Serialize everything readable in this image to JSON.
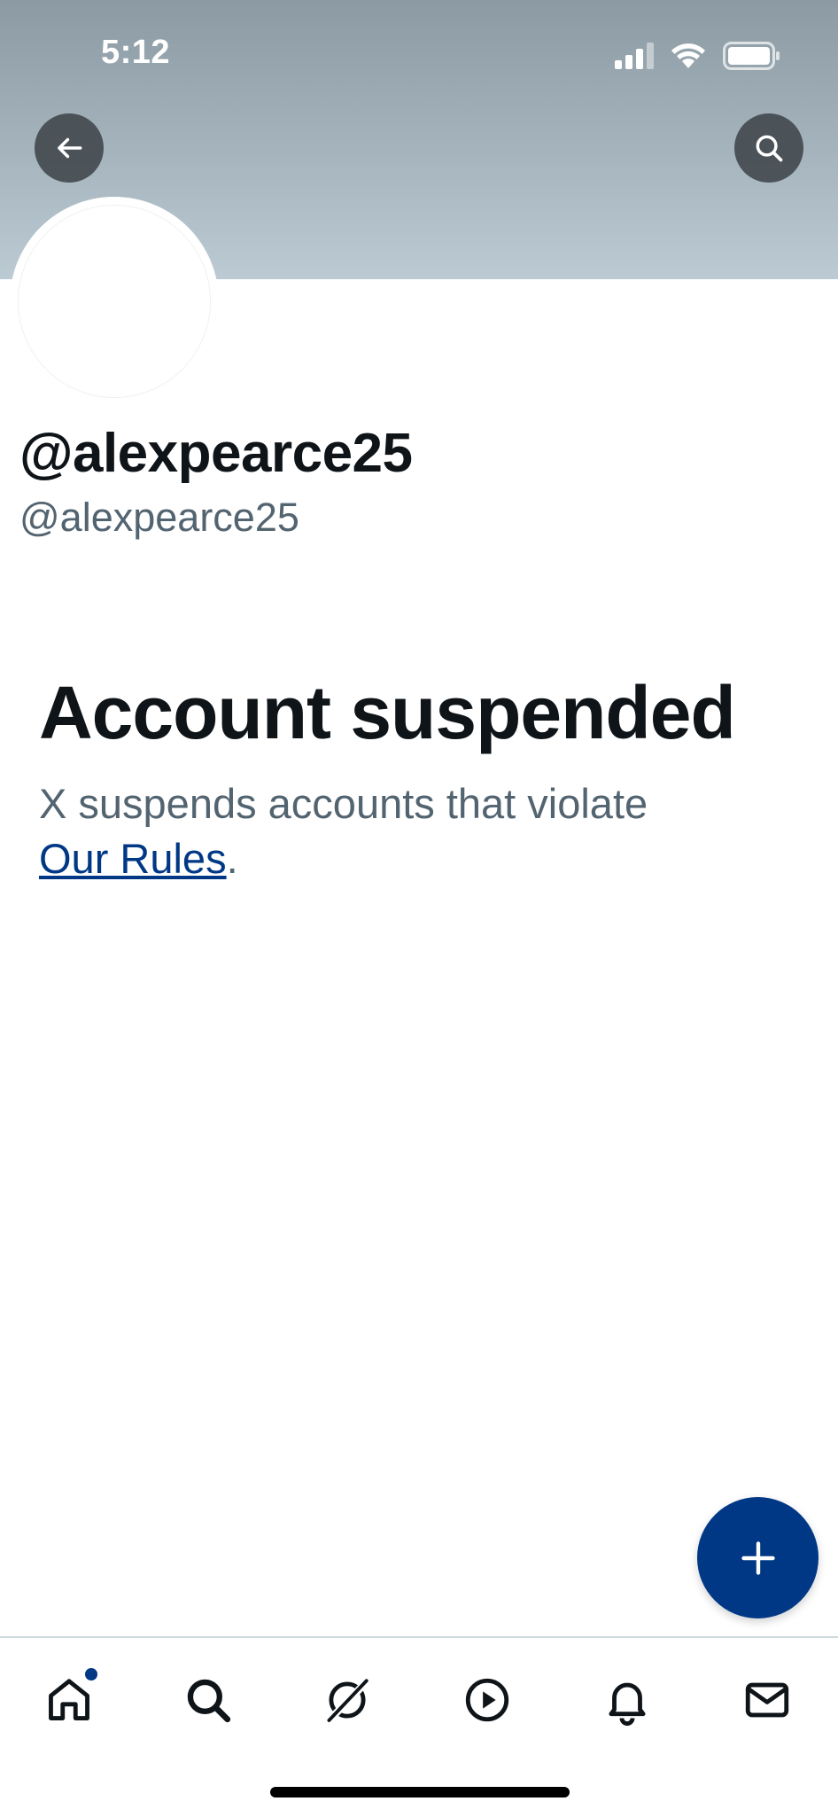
{
  "status_bar": {
    "time": "5:12",
    "icons": [
      "cellular-signal-icon",
      "wifi-icon",
      "battery-icon"
    ]
  },
  "header": {
    "back_icon": "arrow-left-icon",
    "search_icon": "search-icon"
  },
  "profile": {
    "display_name": "@alexpearce25",
    "handle": "@alexpearce25"
  },
  "suspension_notice": {
    "title": "Account suspended",
    "body": "X suspends accounts that violate ",
    "link_text": "Our Rules",
    "trailing": "."
  },
  "compose_fab": {
    "icon": "plus-icon"
  },
  "tab_bar": {
    "items": [
      {
        "name": "home",
        "icon": "home-icon",
        "has_notification_dot": true
      },
      {
        "name": "search",
        "icon": "search-icon"
      },
      {
        "name": "grok",
        "icon": "grok-icon"
      },
      {
        "name": "video",
        "icon": "play-icon"
      },
      {
        "name": "notifications",
        "icon": "bell-icon"
      },
      {
        "name": "messages",
        "icon": "mail-icon"
      }
    ]
  },
  "colors": {
    "accent": "#003886",
    "text_primary": "#0f1419",
    "text_secondary": "#536471",
    "banner_top": "#8c9aa3",
    "banner_bottom": "#bccbd3"
  }
}
